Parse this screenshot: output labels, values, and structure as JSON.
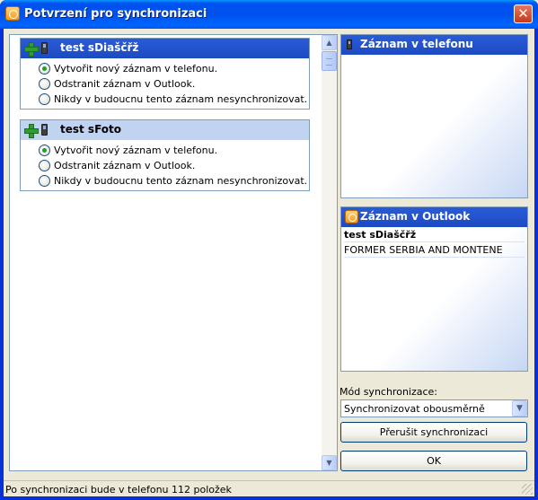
{
  "window": {
    "title": "Potvrzení pro synchronizaci",
    "close_label": "✕"
  },
  "records": [
    {
      "name": "test sDiaščřž",
      "options": [
        {
          "label": "Vytvořit nový záznam v telefonu.",
          "checked": true
        },
        {
          "label": "Odstranit záznam v Outlook.",
          "checked": false
        },
        {
          "label": "Nikdy v budoucnu tento záznam nesynchronizovat.",
          "checked": false
        }
      ]
    },
    {
      "name": "test sFoto",
      "options": [
        {
          "label": "Vytvořit nový záznam v telefonu.",
          "checked": true
        },
        {
          "label": "Odstranit záznam v Outlook.",
          "checked": false
        },
        {
          "label": "Nikdy v budoucnu tento záznam nesynchronizovat.",
          "checked": false
        }
      ]
    }
  ],
  "phone_panel": {
    "title": "Záznam v telefonu"
  },
  "outlook_panel": {
    "title": "Záznam v Outlook",
    "lines": [
      "test sDiaščřž",
      "FORMER SERBIA AND MONTENE"
    ]
  },
  "mode": {
    "label": "Mód synchronizace:",
    "value": "Synchronizovat obousměrně"
  },
  "buttons": {
    "abort": "Přerušit synchronizaci",
    "ok": "OK"
  },
  "status": "Po synchronizaci bude v telefonu 112 položek",
  "scroll": {
    "up_arrow": "▲",
    "down_arrow": "▼"
  },
  "icons": {
    "add": "plus-icon",
    "phone": "phone-icon",
    "outlook": "outlook-icon"
  }
}
